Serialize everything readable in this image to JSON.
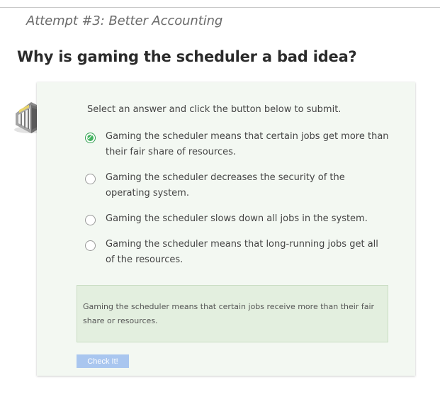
{
  "page": {
    "subtitle": "Attempt #3: Better Accounting",
    "question": "Why is gaming the scheduler a bad idea?"
  },
  "quiz": {
    "icon": "scheduler-quiz-icon",
    "instructions": "Select an answer and click the button below to submit.",
    "options": [
      {
        "label": "Gaming the scheduler means that certain jobs get more than their fair share of resources.",
        "selected": true
      },
      {
        "label": "Gaming the scheduler decreases the security of the operating system.",
        "selected": false
      },
      {
        "label": "Gaming the scheduler slows down all jobs in the system.",
        "selected": false
      },
      {
        "label": "Gaming the scheduler means that long-running jobs get all of the resources.",
        "selected": false
      }
    ],
    "feedback": "Gaming the scheduler means that certain jobs receive more than their fair share or resources.",
    "check_button": "Check It!"
  },
  "colors": {
    "card_background": "#f3f8f2",
    "feedback_background": "#e3efdf",
    "selected_radio": "#41b35e",
    "button_background": "#a9c6ef"
  }
}
